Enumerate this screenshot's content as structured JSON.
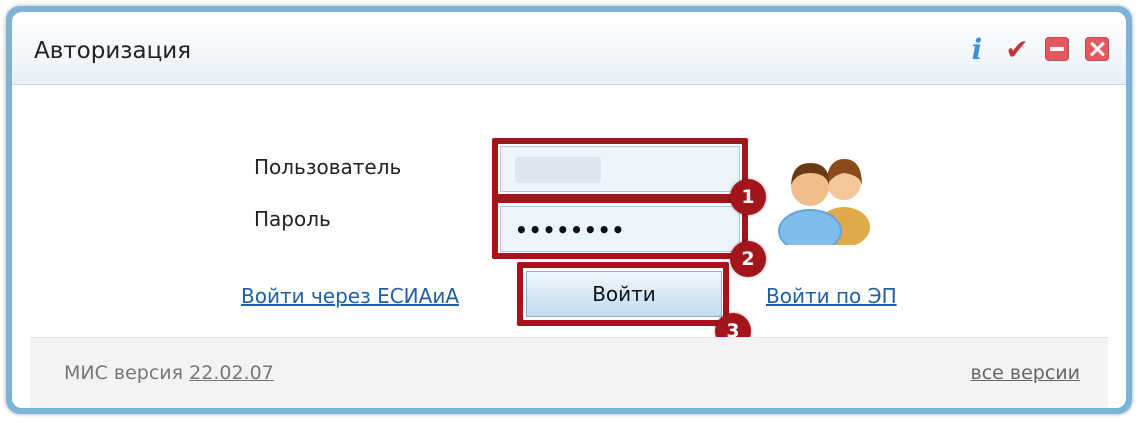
{
  "window": {
    "title": "Авторизация",
    "info_glyph": "i",
    "icons": [
      "info-icon",
      "check-icon",
      "minimize-icon",
      "close-icon"
    ]
  },
  "form": {
    "username_label": "Пользователь",
    "username_value": "",
    "password_label": "Пароль",
    "password_value": "••••••••",
    "login_button": "Войти",
    "esia_link": "Войти через ЕСИАиА",
    "ep_link": "Войти по ЭП"
  },
  "annotations": {
    "badge1": "1",
    "badge2": "2",
    "badge3": "3",
    "highlight_color": "#a3151a"
  },
  "footer": {
    "version_label": "МИС версия",
    "version_number": "22.02.07",
    "all_versions": "все версии"
  },
  "colors": {
    "window_border": "#7ab4d8",
    "link": "#1f5fa8",
    "close_button": "#e05a60"
  }
}
